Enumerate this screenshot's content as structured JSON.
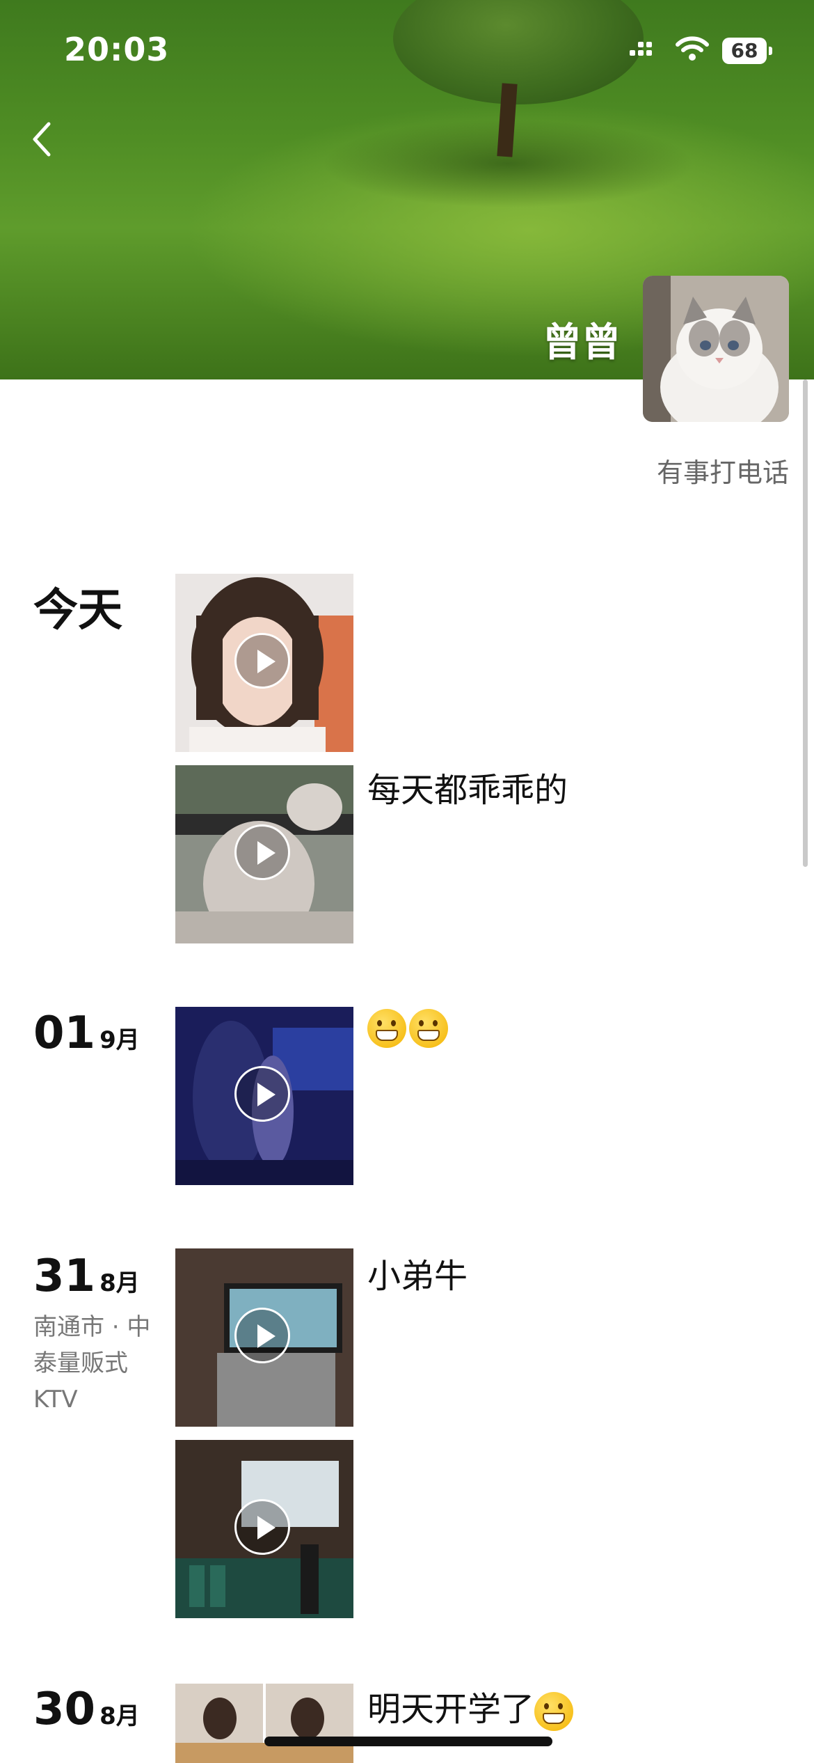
{
  "status_bar": {
    "time": "20:03",
    "battery": "68"
  },
  "profile": {
    "nickname": "曾曾",
    "signature": "有事打电话"
  },
  "posts": [
    {
      "date_label": "今天",
      "caption": "每天都乖乖的"
    },
    {
      "day": "01",
      "month": "9月",
      "caption": ""
    },
    {
      "day": "31",
      "month": "8月",
      "location": "南通市 · 中泰量贩式KTV",
      "caption": "小弟牛"
    },
    {
      "day": "30",
      "month": "8月",
      "caption": "明天开学了"
    }
  ],
  "icons": {
    "back": "chevron-left-icon",
    "emoji": "grinning-face-icon",
    "play": "play-icon"
  }
}
